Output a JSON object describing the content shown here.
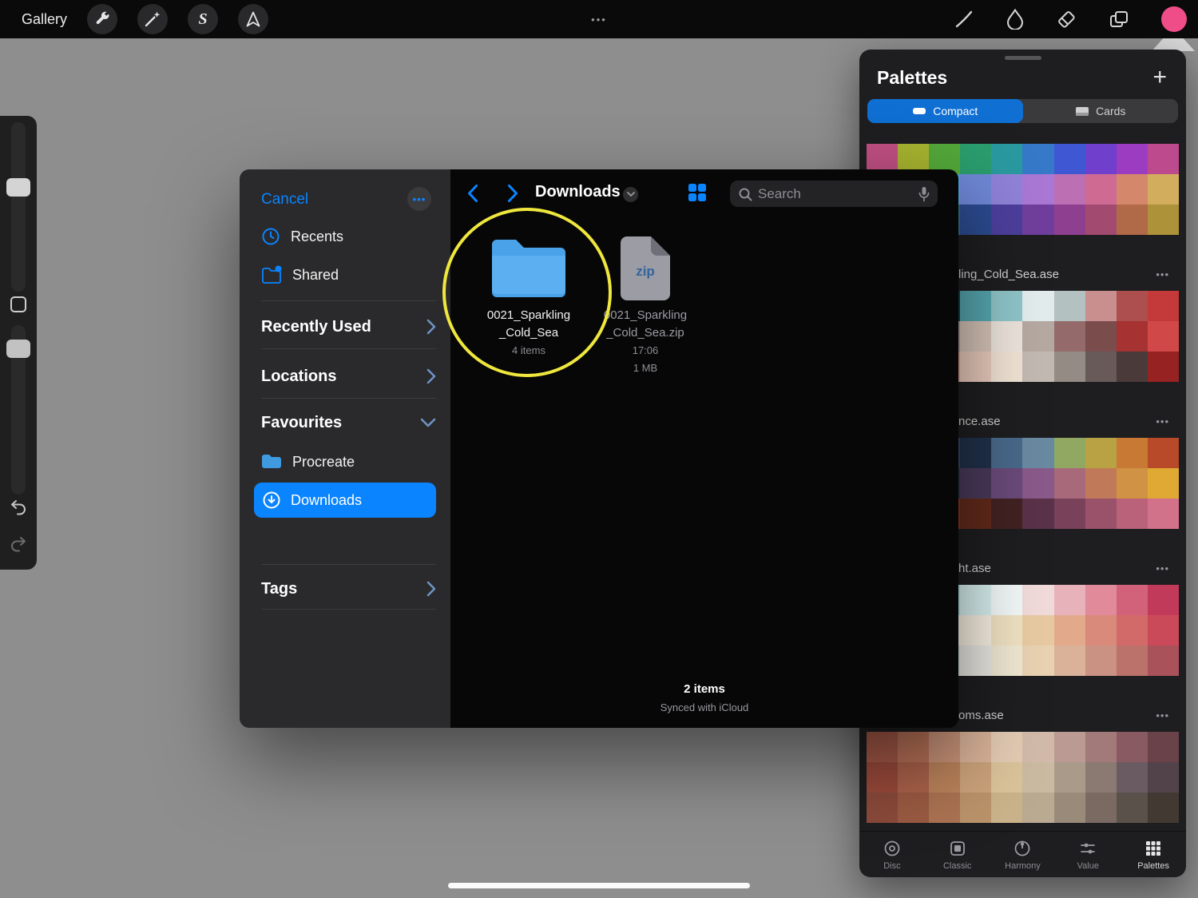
{
  "topbar": {
    "gallery_label": "Gallery",
    "overflow_dots": "•••",
    "selection_glyph": "S",
    "accent_color": "#ef4d87"
  },
  "file_picker": {
    "sidebar": {
      "cancel_label": "Cancel",
      "more_dots": "•••",
      "quick_items": [
        {
          "label": "Recents"
        },
        {
          "label": "Shared"
        }
      ],
      "sections": [
        {
          "label": "Recently Used"
        },
        {
          "label": "Locations"
        },
        {
          "label": "Favourites"
        }
      ],
      "favourites_items": [
        {
          "label": "Procreate"
        },
        {
          "label": "Downloads",
          "selected": true
        }
      ],
      "tags_label": "Tags"
    },
    "toolbar": {
      "title": "Downloads",
      "search_placeholder": "Search"
    },
    "files": [
      {
        "type": "folder",
        "name_line1": "0021_Sparkling",
        "name_line2": "_Cold_Sea",
        "meta": "4 items"
      },
      {
        "type": "zip",
        "badge": "zip",
        "name_line1": "0021_Sparkling",
        "name_line2": "_Cold_Sea.zip",
        "time": "17:06",
        "size": "1 MB"
      }
    ],
    "footer": {
      "count": "2 items",
      "sync": "Synced with iCloud"
    }
  },
  "palettes_panel": {
    "title": "Palettes",
    "add_label": "+",
    "ellipsis": "•••",
    "tabs": [
      {
        "label": "Compact",
        "selected": true
      },
      {
        "label": "Cards",
        "selected": false
      }
    ],
    "palettes": [
      {
        "name": "",
        "swatches": [
          "#bf4f82",
          "#a6b32f",
          "#53a83a",
          "#2a9d6e",
          "#2a9aa0",
          "#3579c8",
          "#3f57d2",
          "#7040cc",
          "#9c3cc0",
          "#bc4a8c",
          "#cf9f30",
          "#2f9f8f",
          "#49a4da",
          "#6f87d6",
          "#8f82d8",
          "#a878d4",
          "#bd6fb4",
          "#cf6a92",
          "#d4876b",
          "#d2ad5d",
          "#7d8f2c",
          "#3d8f49",
          "#2c6f7d",
          "#2c4a8f",
          "#4c3f9d",
          "#703f9d",
          "#8f3f8f",
          "#a24a70",
          "#b06a48",
          "#ad923a"
        ]
      },
      {
        "name": "ling_Cold_Sea.ase",
        "swatches": [
          "#2a8795",
          "#19616f",
          "#143c47",
          "#57a7b0",
          "#8fc5c9",
          "#e3ecec",
          "#b4c1c1",
          "#c98f8f",
          "#ad4f4f",
          "#c43a3a",
          "#d9a6a6",
          "#c4a0a8",
          "#a8969b",
          "#d5c3b6",
          "#ece4dc",
          "#b5a9a2",
          "#946a6a",
          "#7a4c4c",
          "#a63232",
          "#d14848",
          "#8f2a2a",
          "#b85f57",
          "#d9a191",
          "#e8cabb",
          "#f0e3d4",
          "#c2bab2",
          "#948c84",
          "#695a5a",
          "#4a3a3a",
          "#962222"
        ]
      },
      {
        "name": "nce.ase",
        "swatches": [
          "#8c9aac",
          "#5c7189",
          "#2f4a6a",
          "#20314a",
          "#49698a",
          "#6a8aa2",
          "#90a862",
          "#b8a244",
          "#c87a34",
          "#b84a2a",
          "#3a8a7a",
          "#1f5a6a",
          "#2a3a4a",
          "#4a3a5a",
          "#6a4a7a",
          "#8a5a8a",
          "#a86a7a",
          "#c07a5a",
          "#d09244",
          "#dfa934",
          "#d06a32",
          "#b04a22",
          "#8a3222",
          "#622a1a",
          "#422222",
          "#5a324a",
          "#7a425a",
          "#9a526a",
          "#ba627a",
          "#d2728a"
        ]
      },
      {
        "name": "ht.ase",
        "swatches": [
          "#4ab6c6",
          "#7ad0d8",
          "#aae2e8",
          "#d8f0f0",
          "#f2f8f8",
          "#f0dada",
          "#e8b2ba",
          "#e08a9a",
          "#d2627a",
          "#c23a5a",
          "#bad8e0",
          "#d2e8e8",
          "#eaf0e8",
          "#f8f0e2",
          "#f0e2c2",
          "#e8caa2",
          "#e2aa8a",
          "#da8a7a",
          "#d26a6a",
          "#ca4a5a",
          "#8ac2d2",
          "#aad2da",
          "#cae2e2",
          "#eae8e2",
          "#f0e8d2",
          "#e8d2b2",
          "#dab29a",
          "#ca9282",
          "#ba726a",
          "#aa525a"
        ]
      },
      {
        "name": "oms.ase",
        "swatches": [
          "#a65a48",
          "#b87258",
          "#c89278",
          "#d8b298",
          "#e2cab2",
          "#d2baaa",
          "#ba9a92",
          "#a27a7a",
          "#8a5a62",
          "#6a424a",
          "#9a4a3a",
          "#aa624a",
          "#ba825a",
          "#caa27a",
          "#dac29a",
          "#cabaa2",
          "#aa9a8a",
          "#8a7a72",
          "#6a5a62",
          "#52424a",
          "#8a4a3a",
          "#9a5a42",
          "#aa7252",
          "#ba926a",
          "#cab28a",
          "#baaa92",
          "#9a8a7a",
          "#7a6a62",
          "#5a524a",
          "#423a32"
        ]
      }
    ],
    "bottom_tabs": [
      {
        "label": "Disc"
      },
      {
        "label": "Classic"
      },
      {
        "label": "Harmony"
      },
      {
        "label": "Value"
      },
      {
        "label": "Palettes",
        "active": true
      }
    ]
  }
}
